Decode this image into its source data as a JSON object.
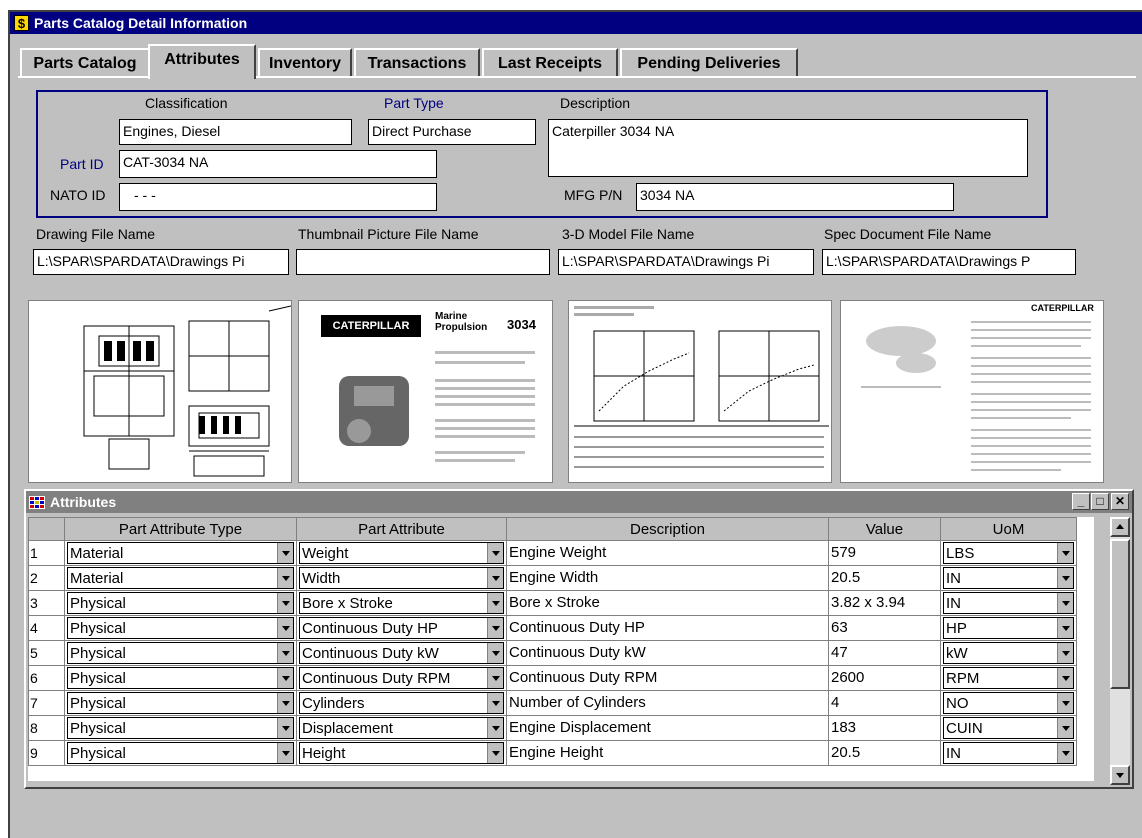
{
  "window": {
    "title": "Parts Catalog Detail Information",
    "icon": "dollar-icon"
  },
  "tabs": [
    {
      "label": "Parts Catalog",
      "active": false
    },
    {
      "label": "Attributes",
      "active": true
    },
    {
      "label": "Inventory",
      "active": false
    },
    {
      "label": "Transactions",
      "active": false
    },
    {
      "label": "Last Receipts",
      "active": false
    },
    {
      "label": "Pending Deliveries",
      "active": false
    }
  ],
  "part": {
    "classification_label": "Classification",
    "classification": "Engines, Diesel",
    "part_type_label": "Part Type",
    "part_type": "Direct Purchase",
    "description_label": "Description",
    "description": "Caterpiller 3034 NA",
    "part_id_label": "Part ID",
    "part_id": "CAT-3034 NA",
    "nato_id_label": "NATO ID",
    "nato_id": "- - -",
    "mfg_pn_label": "MFG P/N",
    "mfg_pn": "3034 NA"
  },
  "files": {
    "drawing_label": "Drawing File Name",
    "drawing": "L:\\SPAR\\SPARDATA\\Drawings Pi",
    "thumbnail_label": "Thumbnail Picture File Name",
    "thumbnail": "",
    "model_label": "3-D Model File Name",
    "model": "L:\\SPAR\\SPARDATA\\Drawings Pi",
    "spec_label": "Spec Document File Name",
    "spec": "L:\\SPAR\\SPARDATA\\Drawings P"
  },
  "thumbnails": {
    "brochure_brand": "CATERPILLAR",
    "brochure_title": "Marine Propulsion",
    "brochure_model": "3034",
    "spec_brand": "CATERPILLAR"
  },
  "attributes_window": {
    "title": "Attributes",
    "columns": [
      "",
      "Part Attribute Type",
      "Part Attribute",
      "Description",
      "Value",
      "UoM"
    ],
    "rows": [
      {
        "n": "1",
        "type": "Material",
        "attribute": "Weight",
        "description": "Engine Weight",
        "value": "579",
        "uom": "LBS"
      },
      {
        "n": "2",
        "type": "Material",
        "attribute": "Width",
        "description": "Engine Width",
        "value": "20.5",
        "uom": "IN"
      },
      {
        "n": "3",
        "type": "Physical",
        "attribute": "Bore x Stroke",
        "description": "Bore x Stroke",
        "value": "3.82 x 3.94",
        "uom": "IN"
      },
      {
        "n": "4",
        "type": "Physical",
        "attribute": "Continuous Duty HP",
        "description": "Continuous Duty HP",
        "value": "63",
        "uom": "HP"
      },
      {
        "n": "5",
        "type": "Physical",
        "attribute": "Continuous Duty kW",
        "description": "Continuous Duty kW",
        "value": "47",
        "uom": "kW"
      },
      {
        "n": "6",
        "type": "Physical",
        "attribute": "Continuous Duty RPM",
        "description": "Continuous Duty RPM",
        "value": "2600",
        "uom": "RPM"
      },
      {
        "n": "7",
        "type": "Physical",
        "attribute": "Cylinders",
        "description": "Number of Cylinders",
        "value": "4",
        "uom": "NO"
      },
      {
        "n": "8",
        "type": "Physical",
        "attribute": "Displacement",
        "description": "Engine Displacement",
        "value": "183",
        "uom": "CUIN"
      },
      {
        "n": "9",
        "type": "Physical",
        "attribute": "Height",
        "description": "Engine Height",
        "value": "20.5",
        "uom": "IN"
      }
    ]
  }
}
